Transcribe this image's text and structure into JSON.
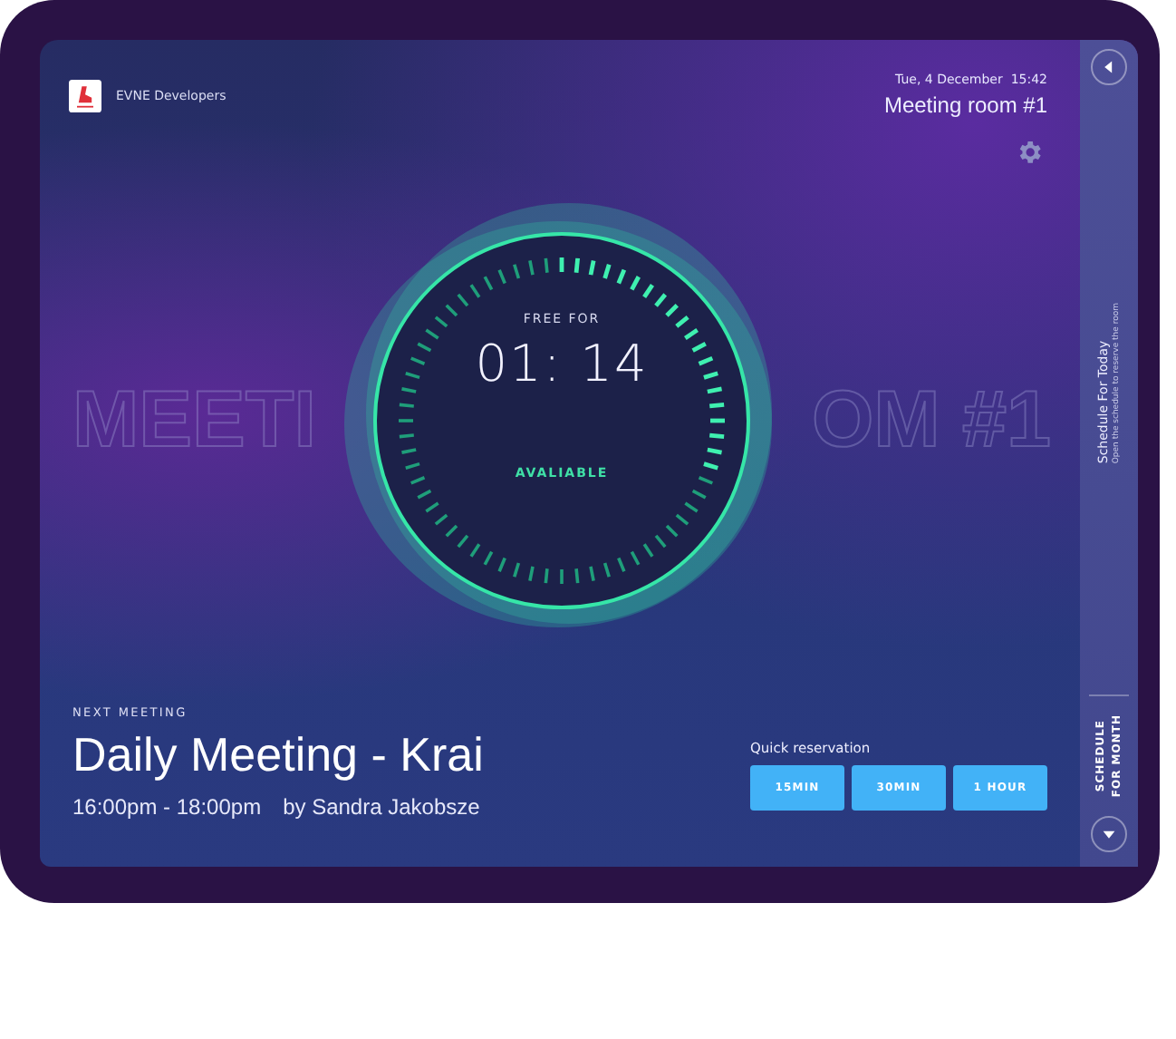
{
  "brand": {
    "name": "EVNE Developers"
  },
  "header": {
    "datetime": "Tue, 4 December  15:42",
    "room": "Meeting room #1"
  },
  "backdrop_text": [
    "MEETI",
    "OM #1"
  ],
  "timer": {
    "label": "FREE FOR",
    "time": "01: 14",
    "status": "AVALIABLE"
  },
  "next_meeting": {
    "label": "NEXT MEETING",
    "title": "Daily Meeting - Krai",
    "time": "16:00pm - 18:00pm",
    "organizer": "by Sandra Jakobsze"
  },
  "quick_reservation": {
    "label": "Quick reservation",
    "buttons": [
      "15MIN",
      "30MIN",
      "1 HOUR"
    ]
  },
  "sidebar": {
    "title": "Schedule For Today",
    "subtitle": "Open the schedule to reserve the room",
    "month_link": [
      "SCHEDULE",
      "FOR MONTH"
    ]
  }
}
